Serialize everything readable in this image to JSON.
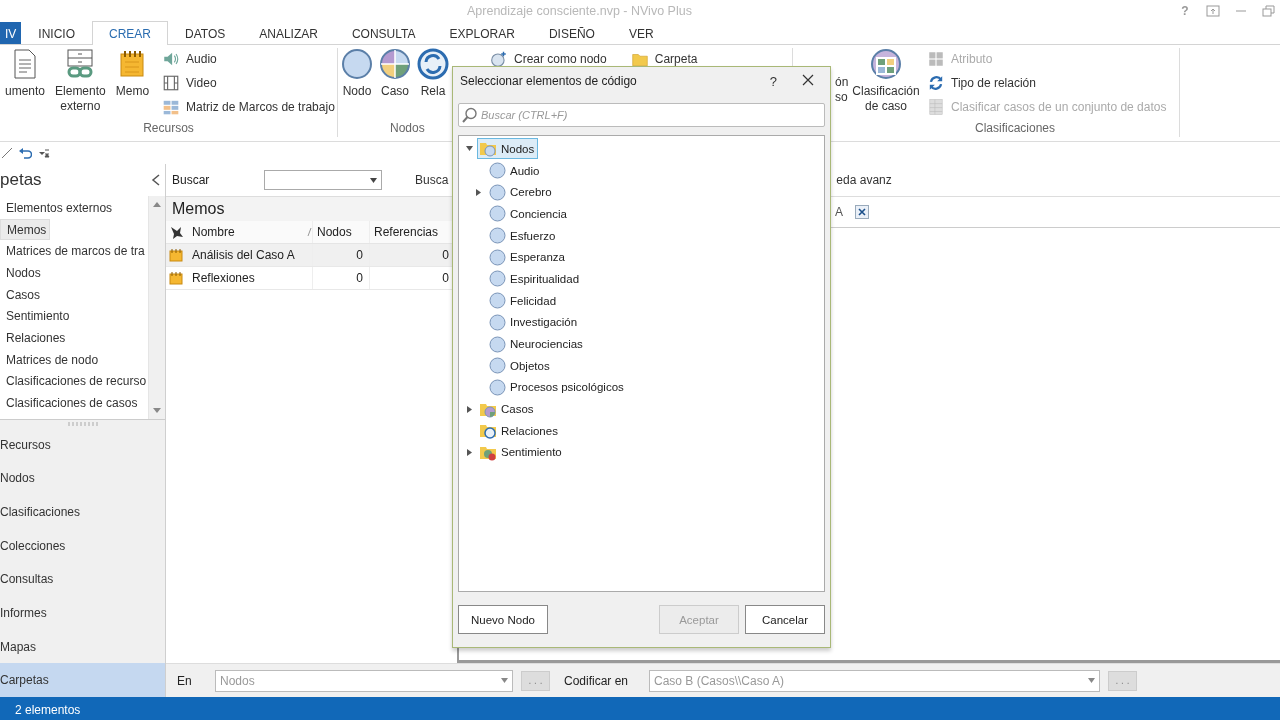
{
  "window": {
    "title": "Aprendizaje consciente.nvp - NVivo Plus",
    "help": "?"
  },
  "ribbon_tabs": [
    {
      "label": "IV",
      "kind": "file",
      "selected": false
    },
    {
      "label": "INICIO",
      "kind": "tab",
      "selected": false
    },
    {
      "label": "CREAR",
      "kind": "tab",
      "selected": true
    },
    {
      "label": "DATOS",
      "kind": "tab",
      "selected": false
    },
    {
      "label": "ANALIZAR",
      "kind": "tab",
      "selected": false
    },
    {
      "label": "CONSULTA",
      "kind": "tab",
      "selected": false
    },
    {
      "label": "EXPLORAR",
      "kind": "tab",
      "selected": false
    },
    {
      "label": "DISEÑO",
      "kind": "tab",
      "selected": false
    },
    {
      "label": "VER",
      "kind": "tab",
      "selected": false
    }
  ],
  "ribbon_groups": [
    {
      "label": "Recursos",
      "large_buttons": [
        {
          "label": "umento",
          "kind": "document"
        },
        {
          "label": "Elemento externo",
          "kind": "external"
        },
        {
          "label": "Memo",
          "kind": "memo"
        }
      ],
      "small_columns": [
        [
          {
            "label": "Audio",
            "kind": "audio",
            "disabled": false
          },
          {
            "label": "Video",
            "kind": "video",
            "disabled": false
          },
          {
            "label": "Matriz de Marcos de trabajo",
            "kind": "matrix",
            "disabled": false
          }
        ]
      ]
    },
    {
      "label": "Nodos",
      "large_buttons": [
        {
          "label": "Nodo",
          "kind": "node"
        },
        {
          "label": "Caso",
          "kind": "case"
        },
        {
          "label": "Rela",
          "kind": "relation"
        }
      ],
      "small_columns": [
        [
          {
            "label": "Crear como nodo",
            "kind": "create-node",
            "disabled": false
          }
        ],
        [
          {
            "label": "Carpeta",
            "kind": "folder",
            "disabled": false
          }
        ]
      ]
    },
    {
      "fragment_lines": [
        "ón",
        "so"
      ]
    },
    {
      "label": "Clasificaciones",
      "large_buttons": [
        {
          "label": "Clasificación de caso",
          "kind": "case-classification"
        }
      ],
      "small_columns": [
        [
          {
            "label": "Atributo",
            "kind": "attribute",
            "disabled": true
          },
          {
            "label": "Tipo de relación",
            "kind": "relation-type",
            "disabled": false
          },
          {
            "label": "Clasificar casos de un conjunto de datos",
            "kind": "dataset",
            "disabled": true
          }
        ]
      ]
    }
  ],
  "navigation": {
    "header": "petas",
    "folders": [
      {
        "label": "Elementos externos",
        "selected": false
      },
      {
        "label": "Memos",
        "selected": true
      },
      {
        "label": "Matrices de marcos de tra",
        "selected": false
      },
      {
        "label": "Nodos",
        "selected": false
      },
      {
        "label": "Casos",
        "selected": false
      },
      {
        "label": "Sentimiento",
        "selected": false
      },
      {
        "label": "Relaciones",
        "selected": false
      },
      {
        "label": "Matrices de nodo",
        "selected": false
      },
      {
        "label": "Clasificaciones de recurso",
        "selected": false
      },
      {
        "label": "Clasificaciones de casos",
        "selected": false
      }
    ],
    "sections": [
      {
        "label": "Recursos",
        "selected": false
      },
      {
        "label": "Nodos",
        "selected": false
      },
      {
        "label": "Clasificaciones",
        "selected": false
      },
      {
        "label": "Colecciones",
        "selected": false
      },
      {
        "label": "Consultas",
        "selected": false
      },
      {
        "label": "Informes",
        "selected": false
      },
      {
        "label": "Mapas",
        "selected": false
      },
      {
        "label": "Carpetas",
        "selected": true
      }
    ]
  },
  "find_bar": {
    "label": "Buscar",
    "find_button": "Busca",
    "advanced": "eda avanz"
  },
  "list_view": {
    "title": "Memos",
    "columns": [
      "Nombre",
      "Nodos",
      "Referencias"
    ],
    "rows": [
      {
        "cells": [
          "Análisis del Caso A",
          "0",
          "0"
        ],
        "selected": true
      },
      {
        "cells": [
          "Reflexiones",
          "0",
          "0"
        ],
        "selected": false
      }
    ]
  },
  "detail_tab": {
    "label": "A"
  },
  "coding_bar": {
    "in_label": "En",
    "in_value": "Nodos",
    "in_browse": ". . .",
    "codify_label": "Codificar en",
    "codify_value": "Caso B (Casos\\\\Caso A)",
    "codify_browse": ". . ."
  },
  "status_bar": {
    "text": "2 elementos"
  },
  "dialog": {
    "title": "Seleccionar elementos de código",
    "help": "?",
    "search_placeholder": "Buscar (CTRL+F)",
    "tree": [
      {
        "label": "Nodos",
        "kind": "nodes-folder",
        "expanded": true,
        "selected": true,
        "children": [
          {
            "label": "Audio",
            "kind": "node",
            "selected": false
          },
          {
            "label": "Cerebro",
            "kind": "node",
            "expanded": false,
            "selected": false
          },
          {
            "label": "Conciencia",
            "kind": "node",
            "selected": false
          },
          {
            "label": "Esfuerzo",
            "kind": "node",
            "selected": false
          },
          {
            "label": "Esperanza",
            "kind": "node",
            "selected": false
          },
          {
            "label": "Espiritualidad",
            "kind": "node",
            "selected": false
          },
          {
            "label": "Felicidad",
            "kind": "node",
            "selected": false
          },
          {
            "label": "Investigación",
            "kind": "node",
            "selected": false
          },
          {
            "label": "Neurociencias",
            "kind": "node",
            "selected": false
          },
          {
            "label": "Objetos",
            "kind": "node",
            "selected": false
          },
          {
            "label": "Procesos psicológicos",
            "kind": "node",
            "selected": false
          }
        ]
      },
      {
        "label": "Casos",
        "kind": "cases-folder",
        "expanded": false,
        "selected": false
      },
      {
        "label": "Relaciones",
        "kind": "relations-folder",
        "selected": false
      },
      {
        "label": "Sentimiento",
        "kind": "sentiment-folder",
        "expanded": false,
        "selected": false
      }
    ],
    "buttons": [
      {
        "label": "Nuevo Nodo",
        "kind": "left",
        "disabled": false
      },
      {
        "label": "Aceptar",
        "kind": "right",
        "disabled": true
      },
      {
        "label": "Cancelar",
        "kind": "right",
        "disabled": false
      }
    ]
  }
}
